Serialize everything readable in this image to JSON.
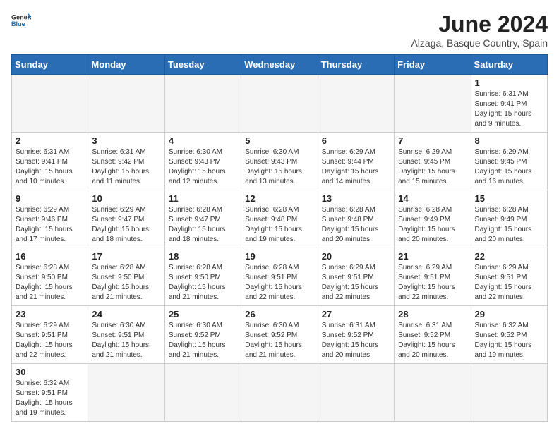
{
  "logo": {
    "text_general": "General",
    "text_blue": "Blue"
  },
  "title": "June 2024",
  "location": "Alzaga, Basque Country, Spain",
  "days_of_week": [
    "Sunday",
    "Monday",
    "Tuesday",
    "Wednesday",
    "Thursday",
    "Friday",
    "Saturday"
  ],
  "weeks": [
    [
      {
        "day": "",
        "text": ""
      },
      {
        "day": "",
        "text": ""
      },
      {
        "day": "",
        "text": ""
      },
      {
        "day": "",
        "text": ""
      },
      {
        "day": "",
        "text": ""
      },
      {
        "day": "",
        "text": ""
      },
      {
        "day": "1",
        "text": "Sunrise: 6:31 AM\nSunset: 9:41 PM\nDaylight: 15 hours\nand 9 minutes."
      }
    ],
    [
      {
        "day": "2",
        "text": "Sunrise: 6:31 AM\nSunset: 9:41 PM\nDaylight: 15 hours\nand 10 minutes."
      },
      {
        "day": "3",
        "text": "Sunrise: 6:31 AM\nSunset: 9:42 PM\nDaylight: 15 hours\nand 11 minutes."
      },
      {
        "day": "4",
        "text": "Sunrise: 6:30 AM\nSunset: 9:43 PM\nDaylight: 15 hours\nand 12 minutes."
      },
      {
        "day": "5",
        "text": "Sunrise: 6:30 AM\nSunset: 9:43 PM\nDaylight: 15 hours\nand 13 minutes."
      },
      {
        "day": "6",
        "text": "Sunrise: 6:29 AM\nSunset: 9:44 PM\nDaylight: 15 hours\nand 14 minutes."
      },
      {
        "day": "7",
        "text": "Sunrise: 6:29 AM\nSunset: 9:45 PM\nDaylight: 15 hours\nand 15 minutes."
      },
      {
        "day": "8",
        "text": "Sunrise: 6:29 AM\nSunset: 9:45 PM\nDaylight: 15 hours\nand 16 minutes."
      }
    ],
    [
      {
        "day": "9",
        "text": "Sunrise: 6:29 AM\nSunset: 9:46 PM\nDaylight: 15 hours\nand 17 minutes."
      },
      {
        "day": "10",
        "text": "Sunrise: 6:29 AM\nSunset: 9:47 PM\nDaylight: 15 hours\nand 18 minutes."
      },
      {
        "day": "11",
        "text": "Sunrise: 6:28 AM\nSunset: 9:47 PM\nDaylight: 15 hours\nand 18 minutes."
      },
      {
        "day": "12",
        "text": "Sunrise: 6:28 AM\nSunset: 9:48 PM\nDaylight: 15 hours\nand 19 minutes."
      },
      {
        "day": "13",
        "text": "Sunrise: 6:28 AM\nSunset: 9:48 PM\nDaylight: 15 hours\nand 20 minutes."
      },
      {
        "day": "14",
        "text": "Sunrise: 6:28 AM\nSunset: 9:49 PM\nDaylight: 15 hours\nand 20 minutes."
      },
      {
        "day": "15",
        "text": "Sunrise: 6:28 AM\nSunset: 9:49 PM\nDaylight: 15 hours\nand 20 minutes."
      }
    ],
    [
      {
        "day": "16",
        "text": "Sunrise: 6:28 AM\nSunset: 9:50 PM\nDaylight: 15 hours\nand 21 minutes."
      },
      {
        "day": "17",
        "text": "Sunrise: 6:28 AM\nSunset: 9:50 PM\nDaylight: 15 hours\nand 21 minutes."
      },
      {
        "day": "18",
        "text": "Sunrise: 6:28 AM\nSunset: 9:50 PM\nDaylight: 15 hours\nand 21 minutes."
      },
      {
        "day": "19",
        "text": "Sunrise: 6:28 AM\nSunset: 9:51 PM\nDaylight: 15 hours\nand 22 minutes."
      },
      {
        "day": "20",
        "text": "Sunrise: 6:29 AM\nSunset: 9:51 PM\nDaylight: 15 hours\nand 22 minutes."
      },
      {
        "day": "21",
        "text": "Sunrise: 6:29 AM\nSunset: 9:51 PM\nDaylight: 15 hours\nand 22 minutes."
      },
      {
        "day": "22",
        "text": "Sunrise: 6:29 AM\nSunset: 9:51 PM\nDaylight: 15 hours\nand 22 minutes."
      }
    ],
    [
      {
        "day": "23",
        "text": "Sunrise: 6:29 AM\nSunset: 9:51 PM\nDaylight: 15 hours\nand 22 minutes."
      },
      {
        "day": "24",
        "text": "Sunrise: 6:30 AM\nSunset: 9:51 PM\nDaylight: 15 hours\nand 21 minutes."
      },
      {
        "day": "25",
        "text": "Sunrise: 6:30 AM\nSunset: 9:52 PM\nDaylight: 15 hours\nand 21 minutes."
      },
      {
        "day": "26",
        "text": "Sunrise: 6:30 AM\nSunset: 9:52 PM\nDaylight: 15 hours\nand 21 minutes."
      },
      {
        "day": "27",
        "text": "Sunrise: 6:31 AM\nSunset: 9:52 PM\nDaylight: 15 hours\nand 20 minutes."
      },
      {
        "day": "28",
        "text": "Sunrise: 6:31 AM\nSunset: 9:52 PM\nDaylight: 15 hours\nand 20 minutes."
      },
      {
        "day": "29",
        "text": "Sunrise: 6:32 AM\nSunset: 9:52 PM\nDaylight: 15 hours\nand 19 minutes."
      }
    ],
    [
      {
        "day": "30",
        "text": "Sunrise: 6:32 AM\nSunset: 9:51 PM\nDaylight: 15 hours\nand 19 minutes."
      },
      {
        "day": "",
        "text": ""
      },
      {
        "day": "",
        "text": ""
      },
      {
        "day": "",
        "text": ""
      },
      {
        "day": "",
        "text": ""
      },
      {
        "day": "",
        "text": ""
      },
      {
        "day": "",
        "text": ""
      }
    ]
  ]
}
